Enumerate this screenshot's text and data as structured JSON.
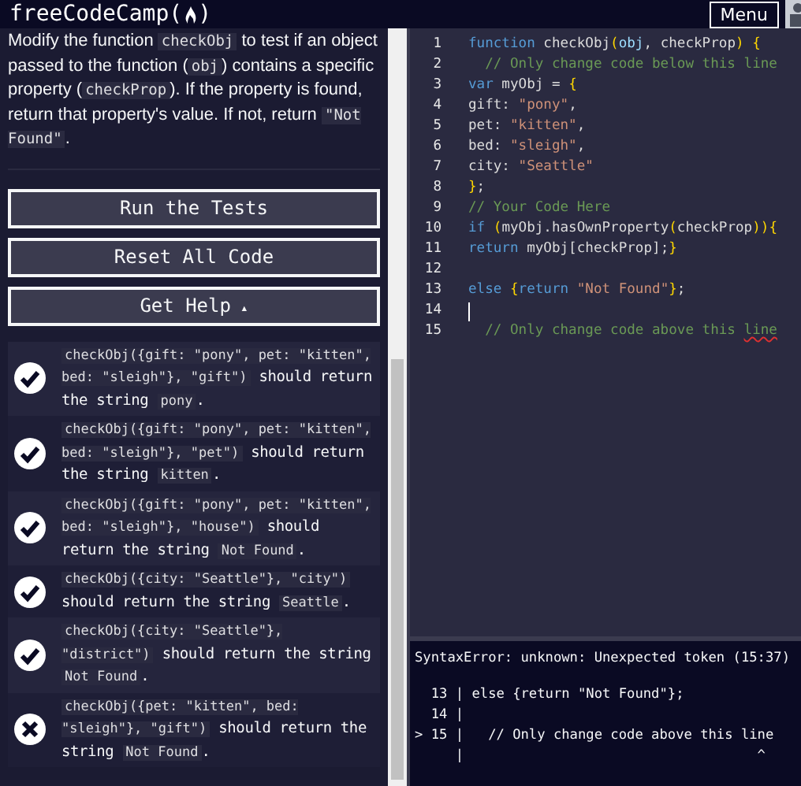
{
  "nav": {
    "brand_prefix": "freeCodeCamp(",
    "brand_suffix": ")",
    "menu_button": "Menu"
  },
  "instructions": [
    {
      "kind": "text",
      "text": "Modify the function "
    },
    {
      "kind": "code",
      "text": "checkObj"
    },
    {
      "kind": "text",
      "text": " to test if an object passed to the function ("
    },
    {
      "kind": "code",
      "text": "obj"
    },
    {
      "kind": "text",
      "text": ") contains a specific property ("
    },
    {
      "kind": "code",
      "text": "checkProp"
    },
    {
      "kind": "text",
      "text": "). If the property is found, return that property's value. If not, return "
    },
    {
      "kind": "code",
      "text": "\"Not Found\""
    },
    {
      "kind": "text",
      "text": "."
    }
  ],
  "buttons": [
    {
      "label": "Run the Tests"
    },
    {
      "label": "Reset All Code"
    },
    {
      "label": "Get Help",
      "caret": "▴"
    }
  ],
  "tests": [
    {
      "passed": true,
      "parts": [
        {
          "kind": "code",
          "text": "checkObj({gift: \"pony\", pet: \"kitten\", bed: \"sleigh\"}, \"gift\")"
        },
        {
          "kind": "text",
          "text": " should return the string "
        },
        {
          "kind": "code",
          "text": "pony"
        },
        {
          "kind": "text",
          "text": "."
        }
      ]
    },
    {
      "passed": true,
      "parts": [
        {
          "kind": "code",
          "text": "checkObj({gift: \"pony\", pet: \"kitten\", bed: \"sleigh\"}, \"pet\")"
        },
        {
          "kind": "text",
          "text": " should return the string "
        },
        {
          "kind": "code",
          "text": "kitten"
        },
        {
          "kind": "text",
          "text": "."
        }
      ]
    },
    {
      "passed": true,
      "parts": [
        {
          "kind": "code",
          "text": "checkObj({gift: \"pony\", pet: \"kitten\", bed: \"sleigh\"}, \"house\")"
        },
        {
          "kind": "text",
          "text": " should return the string "
        },
        {
          "kind": "code",
          "text": "Not Found"
        },
        {
          "kind": "text",
          "text": "."
        }
      ]
    },
    {
      "passed": true,
      "parts": [
        {
          "kind": "code",
          "text": "checkObj({city: \"Seattle\"}, \"city\")"
        },
        {
          "kind": "text",
          "text": " should return the string "
        },
        {
          "kind": "code",
          "text": "Seattle"
        },
        {
          "kind": "text",
          "text": "."
        }
      ]
    },
    {
      "passed": true,
      "parts": [
        {
          "kind": "code",
          "text": "checkObj({city: \"Seattle\"}, \"district\")"
        },
        {
          "kind": "text",
          "text": " should return the string "
        },
        {
          "kind": "code",
          "text": "Not Found"
        },
        {
          "kind": "text",
          "text": "."
        }
      ]
    },
    {
      "passed": false,
      "parts": [
        {
          "kind": "code",
          "text": "checkObj({pet: \"kitten\", bed: \"sleigh\"}, \"gift\")"
        },
        {
          "kind": "text",
          "text": " should return the string "
        },
        {
          "kind": "code",
          "text": "Not Found"
        },
        {
          "kind": "text",
          "text": "."
        }
      ]
    }
  ],
  "editor": {
    "lines": [
      {
        "number": "1",
        "tokens": [
          {
            "kind": "keyword",
            "text": "function"
          },
          {
            "kind": "plain",
            "text": " checkObj"
          },
          {
            "kind": "brace",
            "text": "("
          },
          {
            "kind": "param",
            "text": "obj"
          },
          {
            "kind": "plain",
            "text": ", checkProp"
          },
          {
            "kind": "brace",
            "text": ") "
          },
          {
            "kind": "brace",
            "text": "{"
          }
        ]
      },
      {
        "number": "2",
        "tokens": [
          {
            "kind": "comment",
            "text": "  // Only change code below this line"
          }
        ]
      },
      {
        "number": "3",
        "tokens": [
          {
            "kind": "keyword",
            "text": "var"
          },
          {
            "kind": "plain",
            "text": " myObj = "
          },
          {
            "kind": "brace",
            "text": "{"
          }
        ]
      },
      {
        "number": "4",
        "tokens": [
          {
            "kind": "plain",
            "text": "gift: "
          },
          {
            "kind": "string",
            "text": "\"pony\""
          },
          {
            "kind": "plain",
            "text": ","
          }
        ]
      },
      {
        "number": "5",
        "tokens": [
          {
            "kind": "plain",
            "text": "pet: "
          },
          {
            "kind": "string",
            "text": "\"kitten\""
          },
          {
            "kind": "plain",
            "text": ","
          }
        ]
      },
      {
        "number": "6",
        "tokens": [
          {
            "kind": "plain",
            "text": "bed: "
          },
          {
            "kind": "string",
            "text": "\"sleigh\""
          },
          {
            "kind": "plain",
            "text": ","
          }
        ]
      },
      {
        "number": "7",
        "tokens": [
          {
            "kind": "plain",
            "text": "city: "
          },
          {
            "kind": "string",
            "text": "\"Seattle\""
          }
        ]
      },
      {
        "number": "8",
        "tokens": [
          {
            "kind": "brace",
            "text": "}"
          },
          {
            "kind": "plain",
            "text": ";"
          }
        ]
      },
      {
        "number": "9",
        "tokens": [
          {
            "kind": "comment",
            "text": "// Your Code Here"
          }
        ]
      },
      {
        "number": "10",
        "tokens": [
          {
            "kind": "keyword",
            "text": "if "
          },
          {
            "kind": "brace",
            "text": "("
          },
          {
            "kind": "plain",
            "text": "myObj.hasOwnProperty"
          },
          {
            "kind": "brace",
            "text": "("
          },
          {
            "kind": "plain",
            "text": "checkProp"
          },
          {
            "kind": "brace",
            "text": "))"
          },
          {
            "kind": "brace",
            "text": "{"
          }
        ]
      },
      {
        "number": "11",
        "tokens": [
          {
            "kind": "keyword",
            "text": "return"
          },
          {
            "kind": "plain",
            "text": " myObj[checkProp];"
          },
          {
            "kind": "brace",
            "text": "}"
          }
        ]
      },
      {
        "number": "12"
      },
      {
        "number": "13",
        "tokens": [
          {
            "kind": "keyword",
            "text": "else "
          },
          {
            "kind": "brace",
            "text": "{"
          },
          {
            "kind": "keyword",
            "text": "return "
          },
          {
            "kind": "string",
            "text": "\"Not Found\""
          },
          {
            "kind": "brace",
            "text": "}"
          },
          {
            "kind": "plain",
            "text": ";"
          }
        ]
      },
      {
        "number": "14",
        "cursor": true
      },
      {
        "number": "15",
        "tokens": [
          {
            "kind": "comment",
            "text": "  // Only change code above this "
          },
          {
            "kind": "misspelled",
            "text": "line"
          }
        ]
      }
    ]
  },
  "console": {
    "error": "SyntaxError: unknown: Unexpected token (15:37)",
    "lines": [
      "  13 | else {return \"Not Found\"};",
      "  14 |",
      "> 15 |   // Only change code above this line",
      "     |                                    ^"
    ]
  }
}
